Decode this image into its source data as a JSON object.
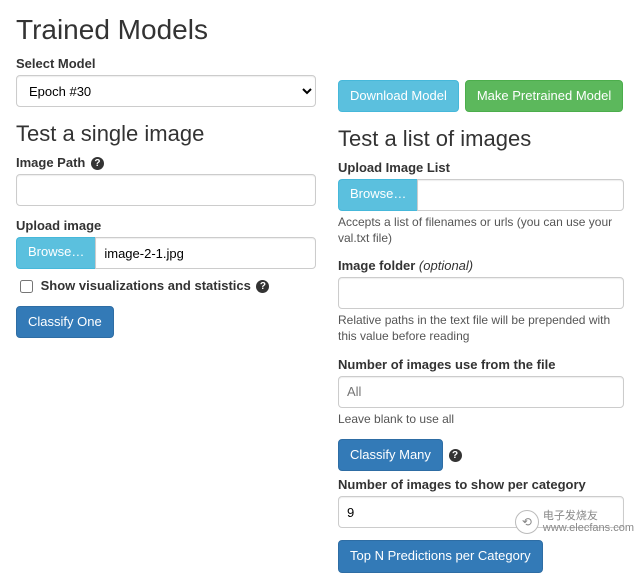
{
  "header": {
    "title": "Trained Models"
  },
  "select_model": {
    "label": "Select Model",
    "value": "Epoch #30"
  },
  "actions": {
    "download": "Download Model",
    "pretrained": "Make Pretrained Model"
  },
  "single": {
    "heading": "Test a single image",
    "image_path_label": "Image Path",
    "upload_label": "Upload image",
    "browse": "Browse…",
    "filename": "image-2-1.jpg",
    "show_viz_label": "Show visualizations and statistics",
    "classify_one": "Classify One"
  },
  "list": {
    "heading": "Test a list of images",
    "upload_list_label": "Upload Image List",
    "browse": "Browse…",
    "upload_list_help": "Accepts a list of filenames or urls (you can use your val.txt file)",
    "folder_label": "Image folder",
    "folder_optional": "(optional)",
    "folder_help": "Relative paths in the text file will be prepended with this value before reading",
    "num_images_label": "Number of images use from the file",
    "num_images_placeholder": "All",
    "num_images_help": "Leave blank to use all",
    "classify_many": "Classify Many",
    "num_per_cat_label": "Number of images to show per category",
    "num_per_cat_value": "9",
    "top_n": "Top N Predictions per Category"
  },
  "watermark": {
    "line1": "电子发烧友",
    "line2": "www.elecfans.com"
  }
}
